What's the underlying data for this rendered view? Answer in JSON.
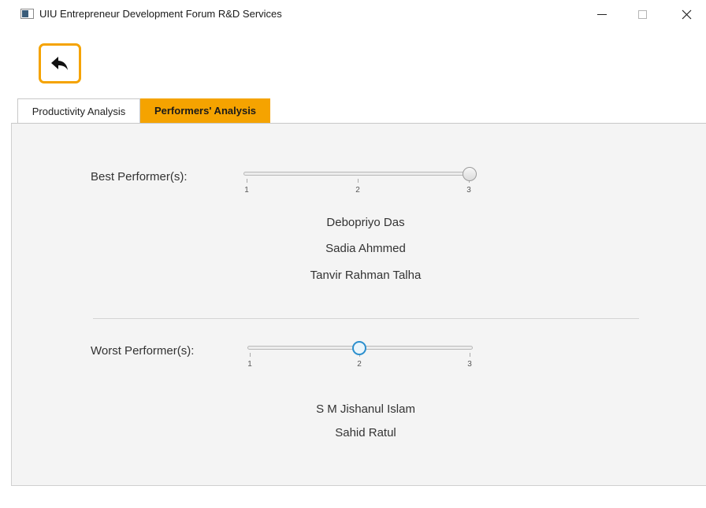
{
  "window": {
    "title": "UIU Entrepreneur Development Forum R&D Services",
    "controls": [
      "minimize",
      "maximize",
      "close"
    ]
  },
  "back_button": {
    "icon": "reply-arrow-icon"
  },
  "tabs": [
    {
      "label": "Productivity Analysis",
      "selected": false
    },
    {
      "label": "Performers' Analysis",
      "selected": true
    }
  ],
  "best": {
    "label": "Best Performer(s):",
    "slider": {
      "min": 1,
      "max": 3,
      "value": 3,
      "ticks": [
        "1",
        "2",
        "3"
      ]
    },
    "names": [
      "Debopriyo Das",
      "Sadia Ahmmed",
      "Tanvir Rahman Talha"
    ]
  },
  "worst": {
    "label": "Worst Performer(s):",
    "slider": {
      "min": 1,
      "max": 3,
      "value": 2,
      "ticks": [
        "1",
        "2",
        "3"
      ]
    },
    "names": [
      "S M Jishanul Islam",
      "Sahid Ratul"
    ]
  },
  "colors": {
    "accent": "#f5a300",
    "focus": "#2b8fce",
    "panel": "#f4f4f4"
  }
}
